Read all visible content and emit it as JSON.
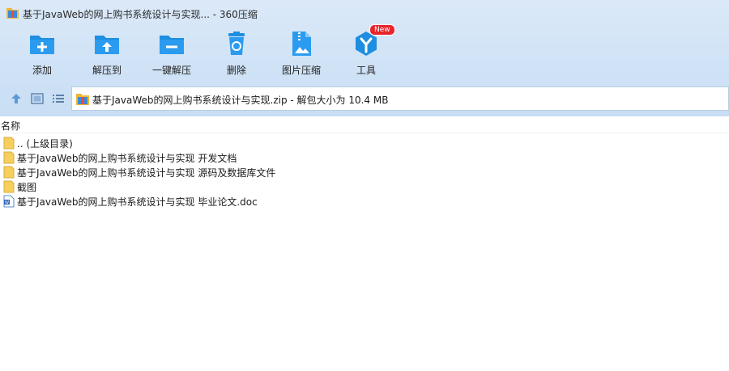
{
  "window": {
    "title": "基于JavaWeb的网上购书系统设计与实现... - 360压缩"
  },
  "toolbar": {
    "items": [
      {
        "label": "添加",
        "icon": "add-folder-icon"
      },
      {
        "label": "解压到",
        "icon": "extract-to-icon"
      },
      {
        "label": "一键解压",
        "icon": "one-click-extract-icon"
      },
      {
        "label": "删除",
        "icon": "delete-icon"
      },
      {
        "label": "图片压缩",
        "icon": "image-compress-icon"
      },
      {
        "label": "工具",
        "icon": "tools-icon",
        "badge": "New"
      }
    ]
  },
  "address": {
    "text": "基于JavaWeb的网上购书系统设计与实现.zip - 解包大小为 10.4 MB"
  },
  "list": {
    "column_name": "名称",
    "rows": [
      {
        "name": ".. (上级目录)",
        "type": "folder"
      },
      {
        "name": "基于JavaWeb的网上购书系统设计与实现 开发文档",
        "type": "folder"
      },
      {
        "name": "基于JavaWeb的网上购书系统设计与实现 源码及数据库文件",
        "type": "folder"
      },
      {
        "name": "截图",
        "type": "folder"
      },
      {
        "name": "基于JavaWeb的网上购书系统设计与实现 毕业论文.doc",
        "type": "doc"
      }
    ]
  },
  "colors": {
    "accent": "#1e8ee0",
    "folder": "#f7cf5f",
    "badge": "#e8252b"
  }
}
